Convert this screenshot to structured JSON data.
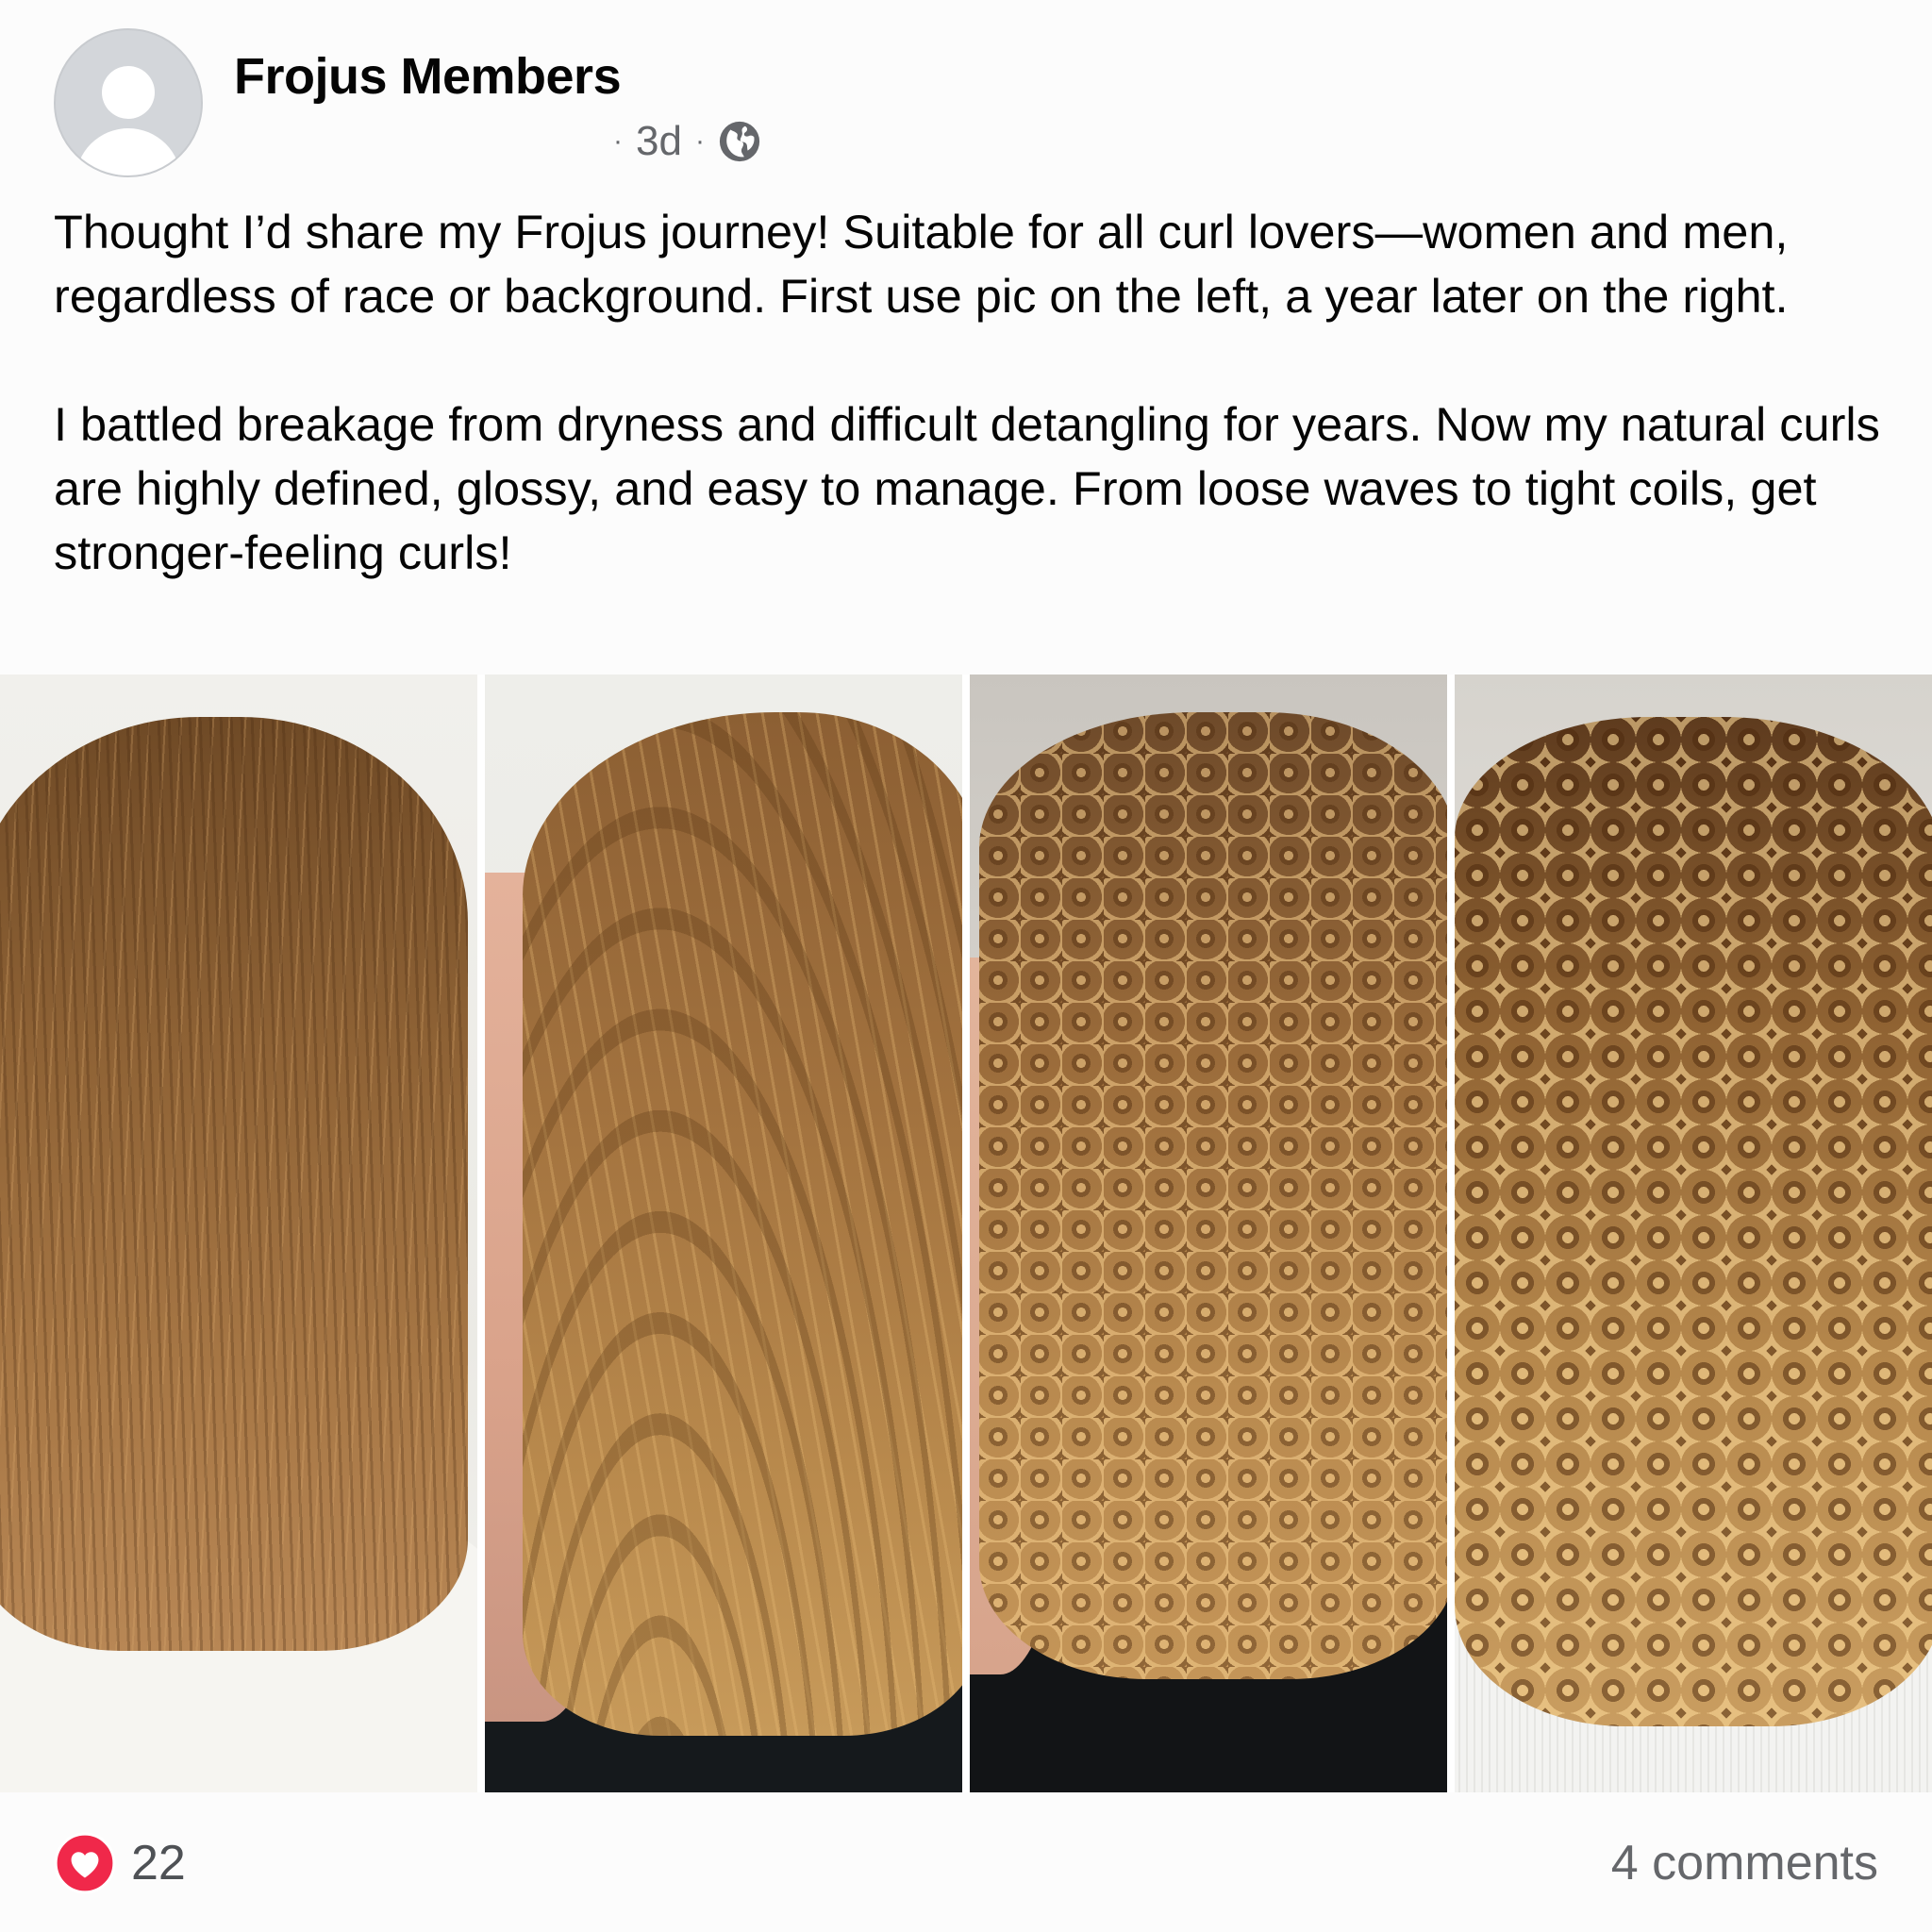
{
  "post": {
    "author": "Frojus Members",
    "separator": "·",
    "timestamp": "3d",
    "privacy_icon": "globe-icon",
    "paragraphs": [
      "Thought I’d share my Frojus journey! Suitable for all curl lovers—women and men, regardless of race or background. First use pic on the left, a year later on the right.",
      "I battled breakage from dryness and difficult detangling for years. Now my natural curls are highly defined, glossy, and easy to manage. From loose waves to tight coils, get stronger-feeling curls!"
    ],
    "photo_count": 4
  },
  "footer": {
    "reaction_icon": "heart-icon",
    "reaction_count": "22",
    "comments_label": "4 comments"
  },
  "colors": {
    "reaction_red": "#f0284a",
    "text_primary": "#050505",
    "text_secondary": "#65676b"
  }
}
